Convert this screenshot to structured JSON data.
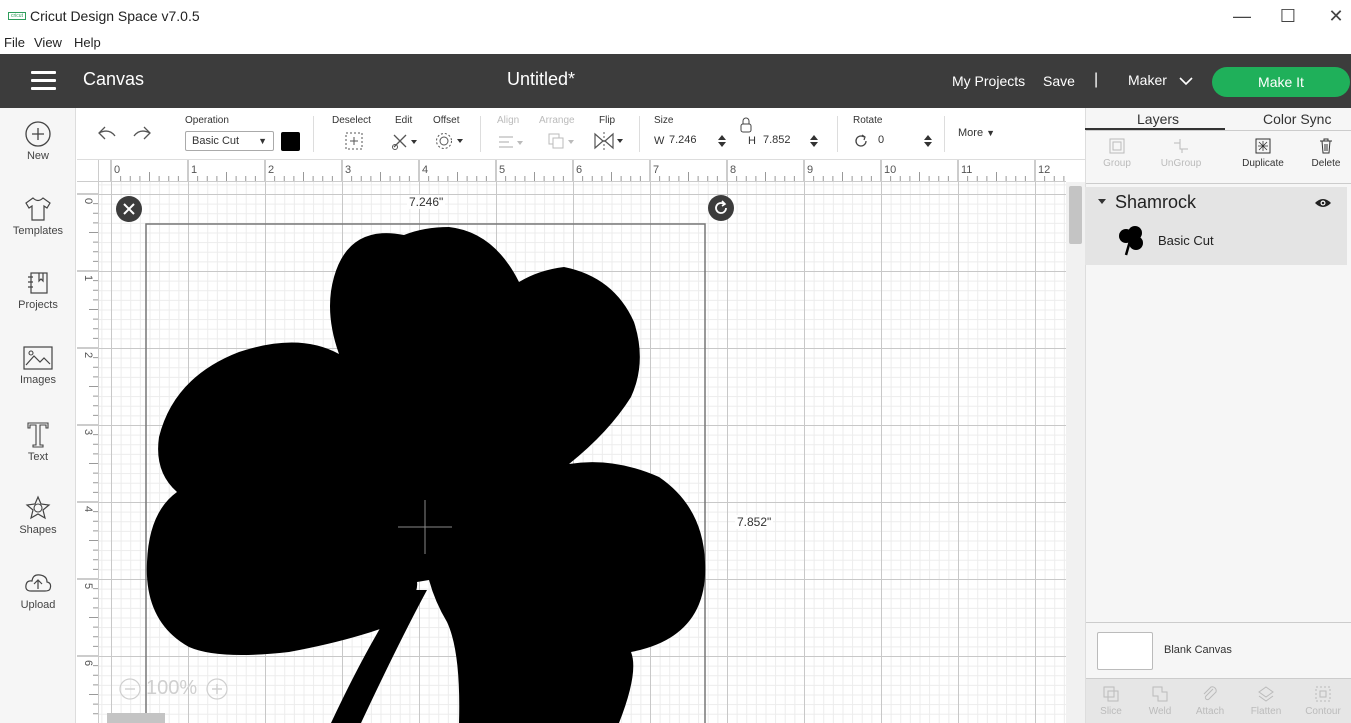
{
  "window": {
    "title": "Cricut Design Space  v7.0.5",
    "logo_text": "cricut",
    "minimize": "—",
    "maximize": "☐",
    "close": "✕"
  },
  "menu": [
    "File",
    "View",
    "Help"
  ],
  "header": {
    "section": "Canvas",
    "doc_title": "Untitled*",
    "my_projects": "My Projects",
    "save": "Save",
    "divider": "|",
    "machine": "Maker",
    "make_it": "Make It"
  },
  "sidebar": [
    {
      "label": "New",
      "icon": "plus-circle-icon"
    },
    {
      "label": "Templates",
      "icon": "tshirt-icon"
    },
    {
      "label": "Projects",
      "icon": "projects-icon"
    },
    {
      "label": "Images",
      "icon": "image-icon"
    },
    {
      "label": "Text",
      "icon": "text-t-icon"
    },
    {
      "label": "Shapes",
      "icon": "shapes-icon"
    },
    {
      "label": "Upload",
      "icon": "upload-cloud-icon"
    }
  ],
  "toolbar": {
    "operation_label": "Operation",
    "operation_value": "Basic Cut",
    "deselect": "Deselect",
    "edit": "Edit",
    "offset": "Offset",
    "align": "Align",
    "arrange": "Arrange",
    "flip": "Flip",
    "size_label": "Size",
    "w_label": "W",
    "w_value": "7.246",
    "h_label": "H",
    "h_value": "7.852",
    "rotate_label": "Rotate",
    "rotate_value": "0",
    "more": "More"
  },
  "ruler": {
    "top": [
      "0",
      "1",
      "2",
      "3",
      "4",
      "5",
      "6",
      "7",
      "8",
      "9",
      "10",
      "11",
      "12"
    ],
    "left": [
      "0",
      "1",
      "2",
      "3",
      "4",
      "5",
      "6"
    ]
  },
  "canvas": {
    "width_dim": "7.246\"",
    "height_dim": "7.852\"",
    "zoom": "100%",
    "shape_color": "#000000"
  },
  "right_panel": {
    "tab_layers": "Layers",
    "tab_color_sync": "Color Sync",
    "actions": [
      {
        "label": "Group",
        "enabled": false
      },
      {
        "label": "UnGroup",
        "enabled": false
      },
      {
        "label": "Duplicate",
        "enabled": true
      },
      {
        "label": "Delete",
        "enabled": true
      }
    ],
    "layer_group_name": "Shamrock",
    "layer_item_name": "Basic Cut",
    "blank_canvas": "Blank Canvas",
    "bottom_actions": [
      "Slice",
      "Weld",
      "Attach",
      "Flatten",
      "Contour"
    ]
  },
  "colors": {
    "header_bg": "#3c3c3c",
    "make_it_green": "#1fb05a",
    "panel_bg": "#f6f6f6"
  }
}
